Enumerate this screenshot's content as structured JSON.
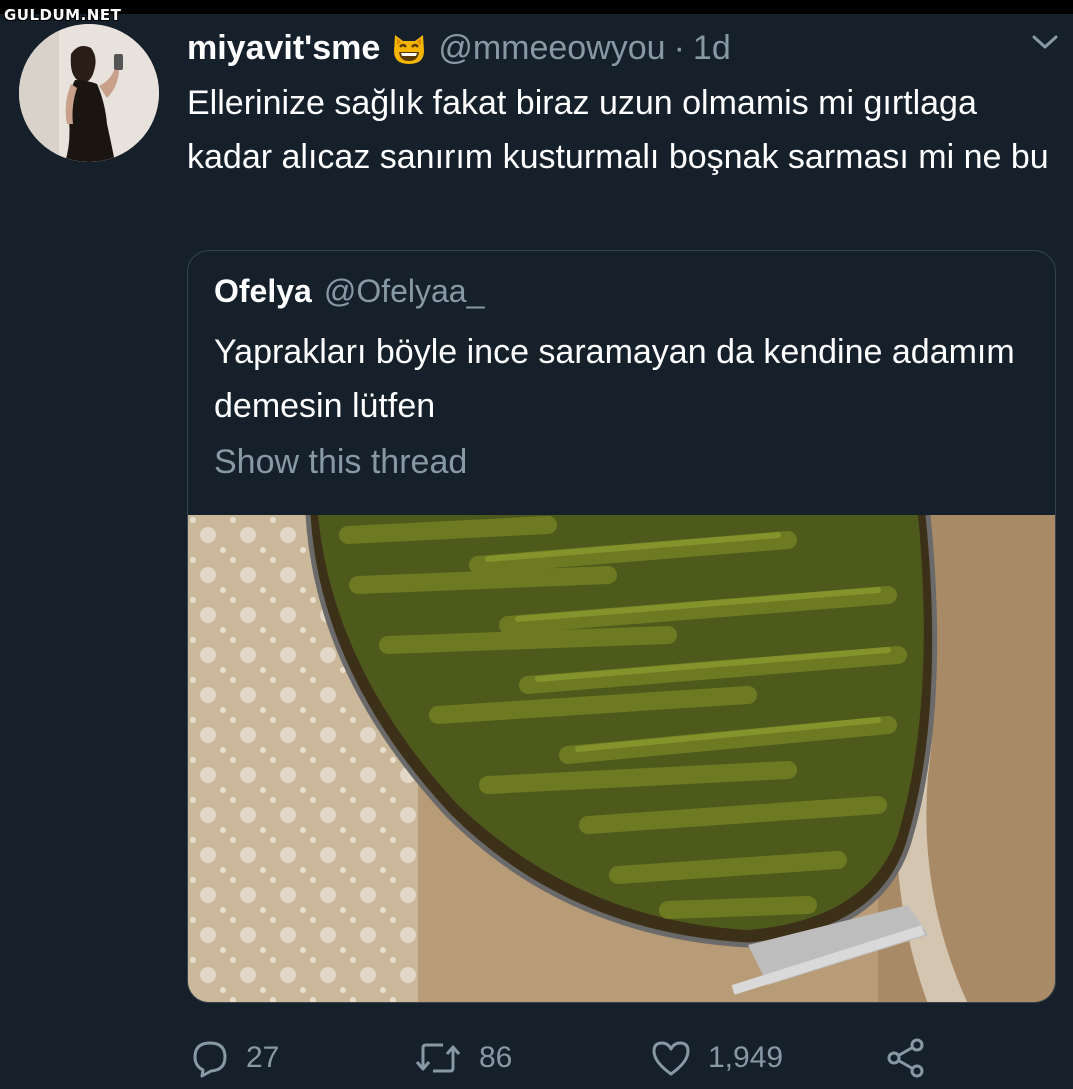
{
  "watermark": "GULDUM.NET",
  "tweet": {
    "name": "miyavit'sme",
    "handle": "@mmeeowyou",
    "separator": "·",
    "time": "1d",
    "text": "Ellerinize sağlık fakat biraz uzun olmamis mi gırtlaga kadar alıcaz sanırım kusturmalı boşnak sarması mi ne bu",
    "emoji_icon": "grinning-cat-icon",
    "caret_icon": "chevron-down-icon"
  },
  "quote": {
    "name": "Ofelya",
    "handle": "@Ofelyaa_",
    "text": "Yaprakları böyle ince saramayan da kendine adamım demesin lütfen",
    "show_thread": "Show this thread"
  },
  "actions": {
    "reply": {
      "icon": "reply-icon",
      "count": "27"
    },
    "retweet": {
      "icon": "retweet-icon",
      "count": "86"
    },
    "like": {
      "icon": "heart-icon",
      "count": "1,949"
    },
    "share": {
      "icon": "share-icon"
    }
  },
  "colors": {
    "background": "#15202b",
    "secondary_text": "#8899a6",
    "border": "#38444d"
  }
}
